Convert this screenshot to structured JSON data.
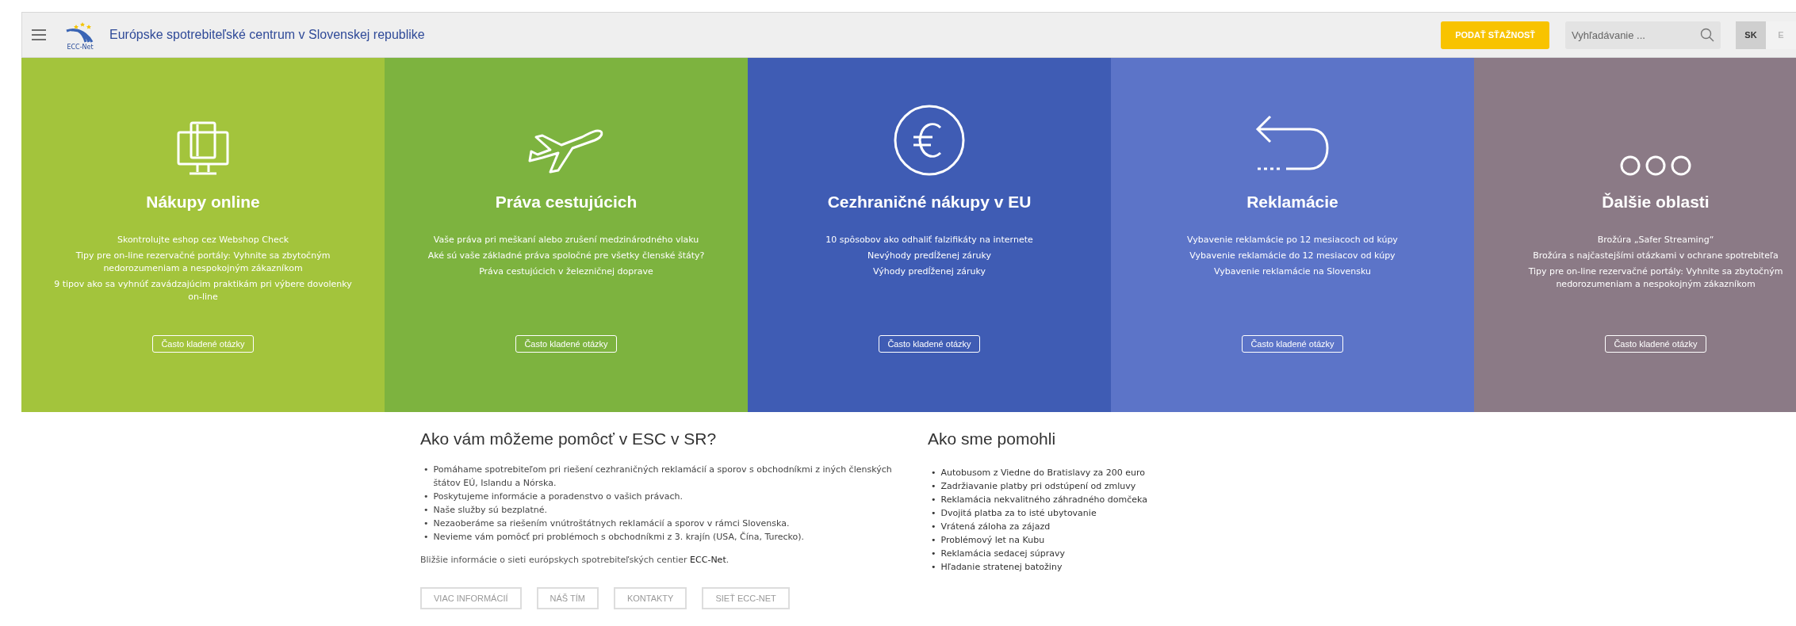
{
  "header": {
    "logo_text": "ECC-Net",
    "title": "Európske spotrebiteľské centrum v Slovenskej republike",
    "complaint_button": "PODAŤ SŤAŽNOSŤ",
    "search": {
      "placeholder": "Vyhľadávanie ..."
    },
    "languages": [
      {
        "label": "SK",
        "selected": true
      },
      {
        "label": "E",
        "selected": false
      }
    ]
  },
  "tiles": [
    {
      "kind": "device",
      "title": "Nákupy online",
      "links": [
        "Skontrolujte eshop cez Webshop Check",
        "Tipy pre on-line rezervačné portály: Vyhnite sa zbytočným nedorozumeniam a nespokojným zákazníkom",
        "9 tipov ako sa vyhnúť zavádzajúcim praktikám pri výbere dovolenky on-line"
      ],
      "button": "Často kladené otázky",
      "color": "#a3c43c"
    },
    {
      "kind": "plane",
      "title": "Práva cestujúcich",
      "links": [
        "Vaše práva pri meškaní alebo zrušení medzinárodného vlaku",
        "Aké sú vaše základné práva spoločné pre všetky členské štáty?",
        "Práva cestujúcich v železničnej doprave"
      ],
      "button": "Často kladené otázky",
      "color": "#7db33f"
    },
    {
      "kind": "euro",
      "title": "Cezhraničné nákupy v EU",
      "links": [
        "10 spôsobov ako odhaliť falzifikáty na internete",
        "Nevýhody predĺženej záruky",
        "Výhody predĺženej záruky"
      ],
      "button": "Často kladené otázky",
      "color": "#3f5cb4"
    },
    {
      "kind": "return",
      "title": "Reklamácie",
      "links": [
        "Vybavenie reklamácie po 12 mesiacoch od kúpy",
        "Vybavenie reklamácie do 12 mesiacov od kúpy",
        "Vybavenie reklamácie na Slovensku"
      ],
      "button": "Často kladené otázky",
      "color": "#5c74c8"
    },
    {
      "kind": "more",
      "title": "Ďalšie oblasti",
      "links": [
        "Brožúra „Safer Streaming“",
        "Brožúra s najčastejšími otázkami v ochrane spotrebiteľa",
        "Tipy pre on-line rezervačné portály: Vyhnite sa zbytočným nedorozumeniam a nespokojným zákazníkom"
      ],
      "button": "Často kladené otázky",
      "color": "#8b7a86"
    }
  ],
  "help": {
    "title": "Ako vám môžeme pomôcť v ESC v SR?",
    "bullet": "•",
    "items": [
      "Pomáhame spotrebiteľom pri riešení cezhraničných reklamácií a sporov s obchodníkmi z iných členských štátov EÚ, Islandu a Nórska.",
      "Poskytujeme informácie a poradenstvo o vašich právach.",
      "Naše služby sú bezplatné.",
      "Nezaoberáme sa riešením vnútroštátnych reklamácií a sporov v rámci Slovenska.",
      "Nevieme vám pomôcť pri problémoch s obchodníkmi z 3. krajín (USA, Čína, Turecko)."
    ],
    "note": "Bližšie informácie o sieti európskych spotrebiteľských centier ",
    "note_link": "ECC-Net",
    "note_end": ".",
    "buttons": [
      "VIAC INFORMÁCIÍ",
      "NÁŠ TÍM",
      "KONTAKTY",
      "SIEŤ ECC-NET"
    ]
  },
  "cases": {
    "title": "Ako sme pomohli",
    "bullet": "•",
    "items": [
      "Autobusom z Viedne do Bratislavy za 200 euro",
      "Zadržiavanie platby pri odstúpení od zmluvy",
      "Reklamácia nekvalitného záhradného domčeka",
      "Dvojitá platba za to isté ubytovanie",
      "Vrátená záloha za zájazd",
      "Problémový let na Kubu",
      "Reklamácia sedacej súpravy",
      "Hľadanie stratenej batožiny"
    ]
  }
}
